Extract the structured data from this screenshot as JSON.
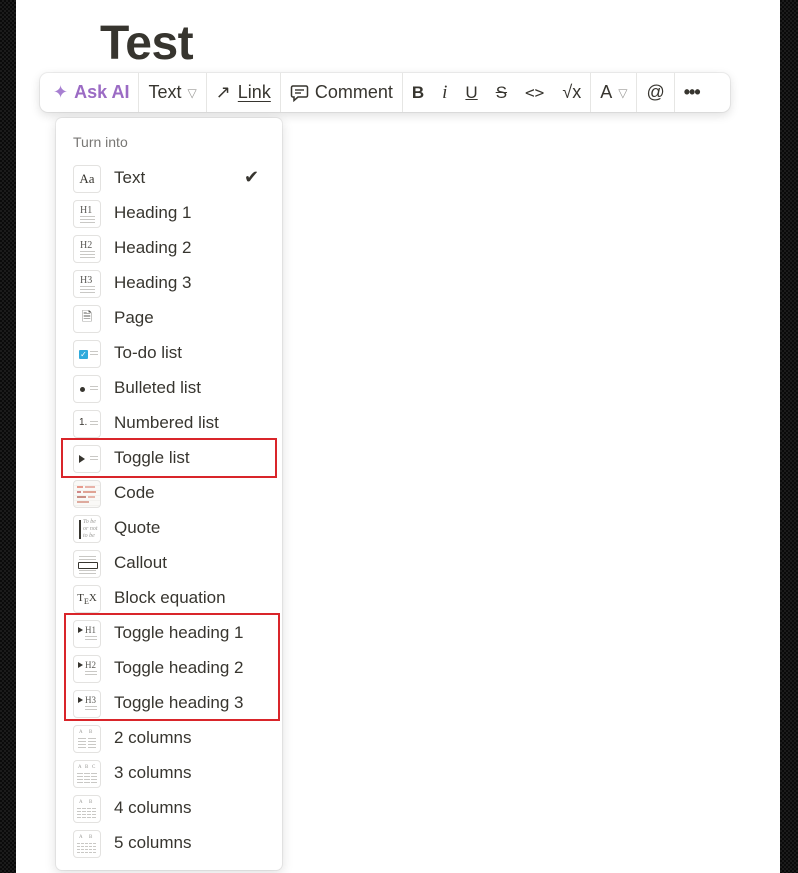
{
  "document": {
    "title": "Test"
  },
  "toolbar": {
    "ask_ai": "Ask AI",
    "text_dropdown": "Text",
    "link": "Link",
    "comment": "Comment",
    "bold": "B",
    "italic": "i",
    "underline": "U",
    "strikethrough": "S",
    "code": "<>",
    "equation": "√x",
    "color": "A",
    "mention": "@",
    "more": "•••"
  },
  "menu": {
    "header": "Turn into",
    "items": [
      {
        "label": "Text",
        "icon": "text-icon",
        "selected": true
      },
      {
        "label": "Heading 1",
        "icon": "heading-1-icon"
      },
      {
        "label": "Heading 2",
        "icon": "heading-2-icon"
      },
      {
        "label": "Heading 3",
        "icon": "heading-3-icon"
      },
      {
        "label": "Page",
        "icon": "page-icon"
      },
      {
        "label": "To-do list",
        "icon": "todo-list-icon"
      },
      {
        "label": "Bulleted list",
        "icon": "bulleted-list-icon"
      },
      {
        "label": "Numbered list",
        "icon": "numbered-list-icon"
      },
      {
        "label": "Toggle list",
        "icon": "toggle-list-icon",
        "highlighted": true
      },
      {
        "label": "Code",
        "icon": "code-icon"
      },
      {
        "label": "Quote",
        "icon": "quote-icon"
      },
      {
        "label": "Callout",
        "icon": "callout-icon"
      },
      {
        "label": "Block equation",
        "icon": "block-equation-icon"
      },
      {
        "label": "Toggle heading 1",
        "icon": "toggle-heading-1-icon",
        "highlighted": true
      },
      {
        "label": "Toggle heading 2",
        "icon": "toggle-heading-2-icon",
        "highlighted": true
      },
      {
        "label": "Toggle heading 3",
        "icon": "toggle-heading-3-icon",
        "highlighted": true
      },
      {
        "label": "2 columns",
        "icon": "two-columns-icon"
      },
      {
        "label": "3 columns",
        "icon": "three-columns-icon"
      },
      {
        "label": "4 columns",
        "icon": "four-columns-icon"
      },
      {
        "label": "5 columns",
        "icon": "five-columns-icon"
      }
    ]
  },
  "colors": {
    "ai_accent": "#9b6bc4",
    "highlight": "#d9252a",
    "text": "#37352f",
    "muted": "#787774"
  }
}
